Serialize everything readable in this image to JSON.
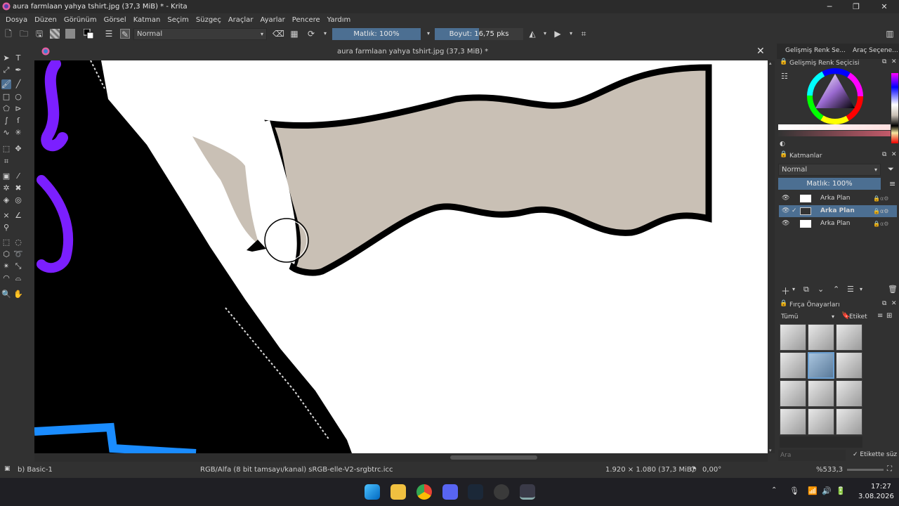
{
  "window": {
    "title": "aura farmlaan yahya tshirt.jpg (37,3 MiB) * - Krita"
  },
  "menu": [
    "Dosya",
    "Düzen",
    "Görünüm",
    "Görsel",
    "Katman",
    "Seçim",
    "Süzgeç",
    "Araçlar",
    "Ayarlar",
    "Pencere",
    "Yardım"
  ],
  "toolbar": {
    "blend_mode": "Normal",
    "opacity_label": "Matlık: 100%",
    "opacity_fraction": 1.0,
    "size_label": "Boyut: 16,75 pks",
    "size_fraction": 0.5
  },
  "document": {
    "tab_title": "aura farmlaan yahya tshirt.jpg (37,3 MiB) *"
  },
  "dockers": {
    "tab_color": "Gelişmiş Renk Se...",
    "tab_tool": "Araç Seçene...",
    "color_title": "Gelişmiş Renk Seçicisi",
    "layers_title": "Katmanlar",
    "layers_blend": "Normal",
    "layers_opacity": "Matlık:  100%",
    "layers": [
      {
        "name": "Arka Plan",
        "selected": false
      },
      {
        "name": "Arka Plan",
        "selected": true
      },
      {
        "name": "Arka Plan",
        "selected": false
      }
    ],
    "brush_title": "Fırça Önayarları",
    "brush_filter": "Tümü",
    "brush_tag": "Etiket",
    "brush_search_placeholder": "Ara",
    "brush_filter_tag": "Etikette süz"
  },
  "status": {
    "brush": "b) Basic-1",
    "color_space": "RGB/Alfa (8 bit tamsayı/kanal) sRGB-elle-V2-srgbtrc.icc",
    "dimensions": "1.920 × 1.080 (37,3 MiB)",
    "rotation": "0,00°",
    "zoom": "%533,3"
  },
  "taskbar": {
    "time": "17:27",
    "date": "3.08.2026"
  },
  "colors": {
    "accent": "#4c6f92",
    "canvas_beige": "#c9c0b5",
    "purple_stroke": "#7b1fff",
    "blue_stroke": "#1a8cff"
  }
}
